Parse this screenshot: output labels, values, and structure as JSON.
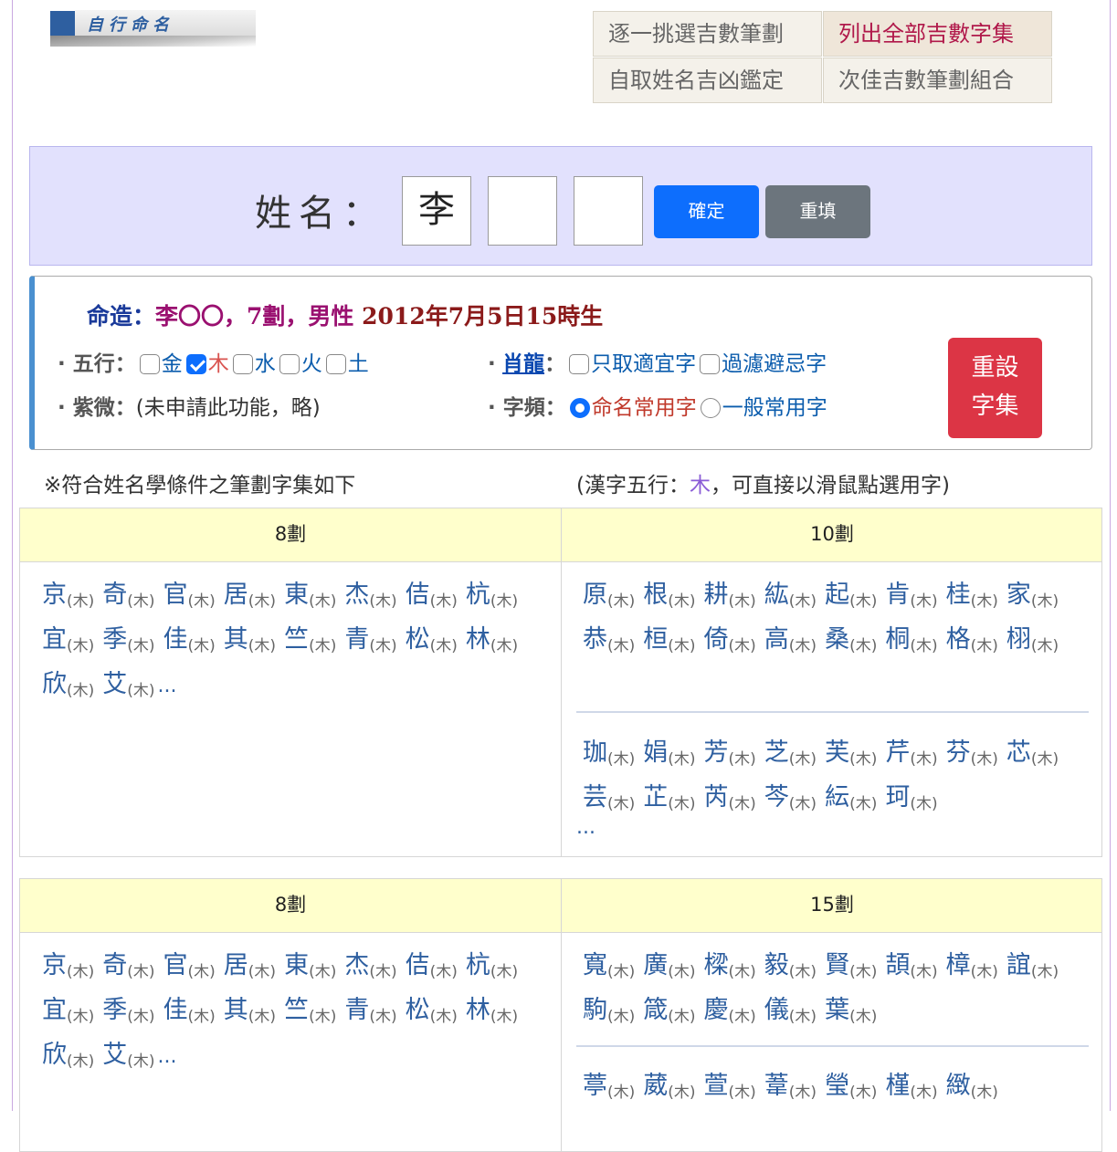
{
  "logo": {
    "text": "自行命名"
  },
  "tabs": [
    {
      "label": "逐一挑選吉數筆劃"
    },
    {
      "label": "列出全部吉數字集"
    },
    {
      "label": "自取姓名吉凶鑑定"
    },
    {
      "label": "次佳吉數筆劃組合"
    }
  ],
  "name_form": {
    "label": "姓名：",
    "surname": "李",
    "given1": "",
    "given2": "",
    "confirm_label": "確定",
    "reset_label": "重填"
  },
  "fate": {
    "label": "命造：",
    "name": "李〇〇，7劃，男性",
    "birth": "2012年7月5日15時生"
  },
  "wuxing": {
    "label": "· 五行：",
    "options": [
      {
        "label": "金",
        "checked": false
      },
      {
        "label": "木",
        "checked": true
      },
      {
        "label": "水",
        "checked": false
      },
      {
        "label": "火",
        "checked": false
      },
      {
        "label": "土",
        "checked": false
      }
    ]
  },
  "zodiac": {
    "prefix": "·",
    "label": "肖龍",
    "colon": "：",
    "options": [
      {
        "label": "只取適宜字",
        "checked": false
      },
      {
        "label": "過濾避忌字",
        "checked": false
      }
    ]
  },
  "ziwei": {
    "label": "· 紫微：",
    "value": "(未申請此功能，略)"
  },
  "frequency": {
    "label": "· 字頻：",
    "options": [
      {
        "label": "命名常用字",
        "selected": true
      },
      {
        "label": "一般常用字",
        "selected": false
      }
    ]
  },
  "reset_charset_label": [
    "重設",
    "字集"
  ],
  "notes": {
    "left": "※符合姓名學條件之筆劃字集如下",
    "right_prefix": "(漢字五行：",
    "right_element": "木",
    "right_suffix": "，可直接以滑鼠點選用字)"
  },
  "tables": [
    {
      "left_header": "8劃",
      "right_header": "10劃",
      "left_chars": [
        "京",
        "奇",
        "官",
        "居",
        "東",
        "杰",
        "佶",
        "杭",
        "宜",
        "季",
        "佳",
        "其",
        "竺",
        "青",
        "松",
        "林",
        "欣",
        "艾"
      ],
      "right_group1": [
        "原",
        "根",
        "耕",
        "紘",
        "起",
        "肯",
        "桂",
        "家",
        "恭",
        "桓",
        "倚",
        "高",
        "桑",
        "桐",
        "格",
        "栩"
      ],
      "right_group2": [
        "珈",
        "娟",
        "芳",
        "芝",
        "芙",
        "芹",
        "芬",
        "芯",
        "芸",
        "芷",
        "芮",
        "芩",
        "紜",
        "珂"
      ],
      "element": "(木)",
      "more": "..."
    },
    {
      "left_header": "8劃",
      "right_header": "15劃",
      "left_chars": [
        "京",
        "奇",
        "官",
        "居",
        "東",
        "杰",
        "佶",
        "杭",
        "宜",
        "季",
        "佳",
        "其",
        "竺",
        "青",
        "松",
        "林",
        "欣",
        "艾"
      ],
      "right_group1": [
        "寬",
        "廣",
        "樑",
        "毅",
        "賢",
        "頡",
        "樟",
        "誼",
        "駒",
        "箴",
        "慶",
        "儀",
        "葉"
      ],
      "right_group2": [
        "葶",
        "葳",
        "萱",
        "葦",
        "瑩",
        "槿",
        "緻"
      ],
      "element": "(木)",
      "more": "..."
    }
  ]
}
